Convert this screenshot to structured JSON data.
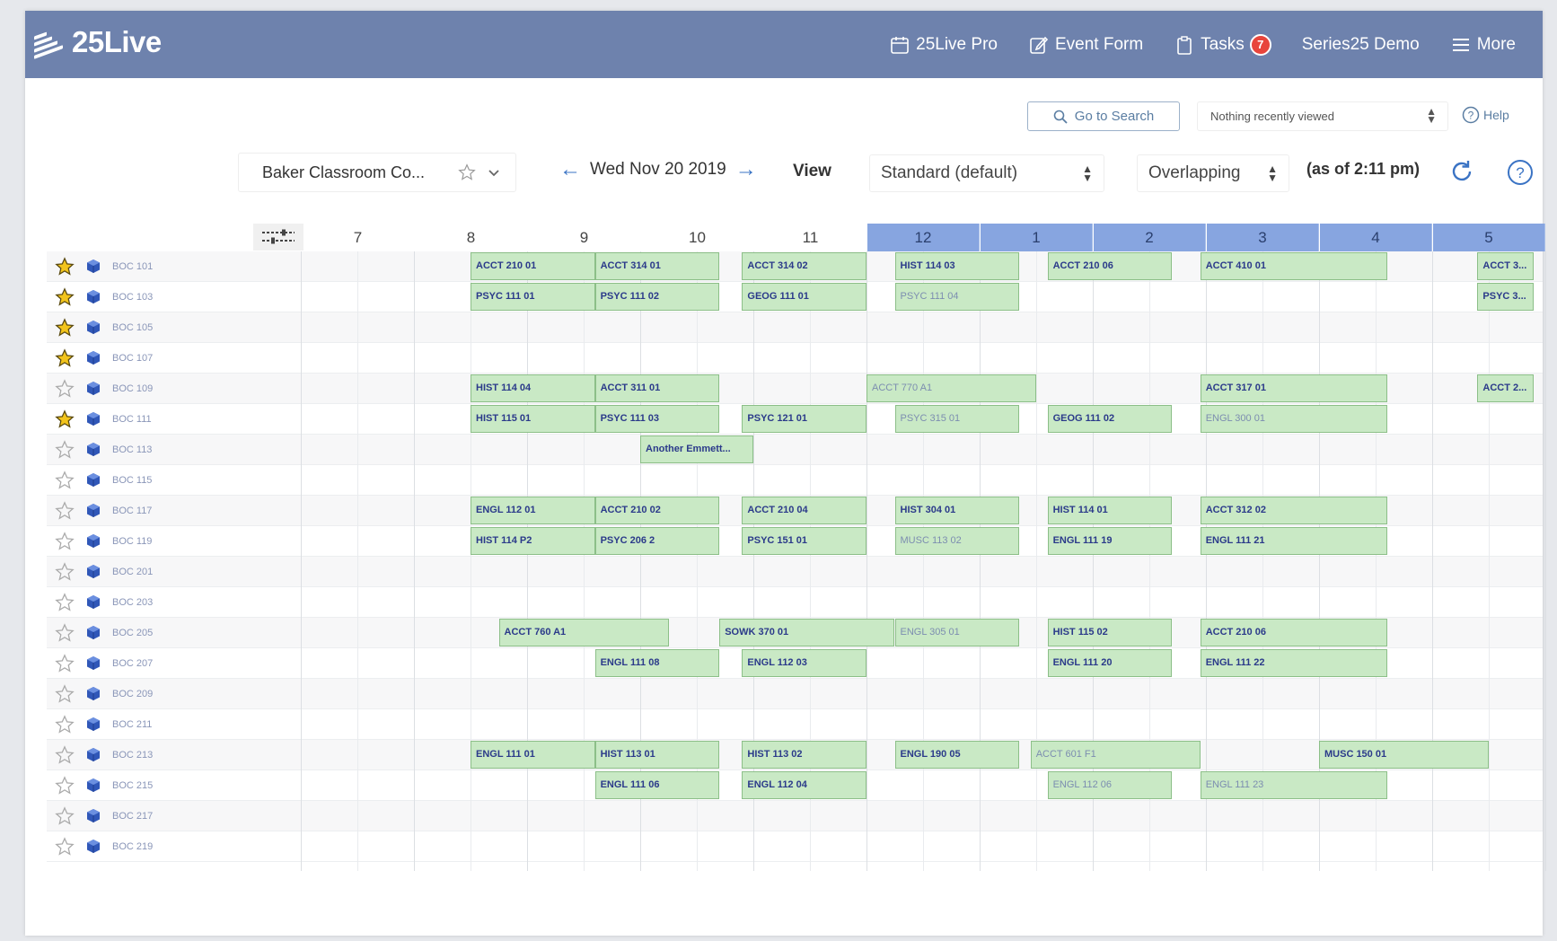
{
  "header": {
    "logo_text": "25Live",
    "nav": [
      {
        "label": "25Live Pro",
        "icon": "calendar-icon"
      },
      {
        "label": "Event Form",
        "icon": "edit-icon"
      },
      {
        "label": "Tasks",
        "icon": "clipboard-icon",
        "badge": "7"
      },
      {
        "label": "Series25 Demo",
        "icon": ""
      },
      {
        "label": "More",
        "icon": "menu-icon"
      }
    ]
  },
  "toolbar": {
    "go_to_search": "Go to Search",
    "recently_viewed": "Nothing recently viewed",
    "help": "Help"
  },
  "controls": {
    "selector": "Baker Classroom Co...",
    "date": "Wed Nov 20 2019",
    "view_label": "View",
    "view_value": "Standard (default)",
    "overlap_value": "Overlapping",
    "as_of": "(as of 2:11 pm)"
  },
  "hours": [
    "7",
    "8",
    "9",
    "10",
    "11",
    "12",
    "1",
    "2",
    "3",
    "4",
    "5"
  ],
  "highlight_start_hour": "12",
  "colors": {
    "topbar": "#6e82ad",
    "event_fill": "#c9e9c5",
    "event_text": "#2b3a8a",
    "pm_header": "#87a5e0",
    "badge": "#e8453c"
  },
  "rooms": [
    {
      "name": "BOC 101",
      "favorite": true
    },
    {
      "name": "BOC 103",
      "favorite": true
    },
    {
      "name": "BOC 105",
      "favorite": true
    },
    {
      "name": "BOC 107",
      "favorite": true
    },
    {
      "name": "BOC 109",
      "favorite": false
    },
    {
      "name": "BOC 111",
      "favorite": true
    },
    {
      "name": "BOC 113",
      "favorite": false
    },
    {
      "name": "BOC 115",
      "favorite": false
    },
    {
      "name": "BOC 117",
      "favorite": false
    },
    {
      "name": "BOC 119",
      "favorite": false
    },
    {
      "name": "BOC 201",
      "favorite": false
    },
    {
      "name": "BOC 203",
      "favorite": false
    },
    {
      "name": "BOC 205",
      "favorite": false
    },
    {
      "name": "BOC 207",
      "favorite": false
    },
    {
      "name": "BOC 209",
      "favorite": false
    },
    {
      "name": "BOC 211",
      "favorite": false
    },
    {
      "name": "BOC 213",
      "favorite": false
    },
    {
      "name": "BOC 215",
      "favorite": false
    },
    {
      "name": "BOC 217",
      "favorite": false
    },
    {
      "name": "BOC 219",
      "favorite": false
    }
  ],
  "events": [
    {
      "row": 0,
      "start": 8.0,
      "end": 9.1,
      "label": "ACCT 210 01"
    },
    {
      "row": 0,
      "start": 9.1,
      "end": 10.2,
      "label": "ACCT 314 01"
    },
    {
      "row": 0,
      "start": 10.4,
      "end": 11.5,
      "label": "ACCT 314 02"
    },
    {
      "row": 0,
      "start": 11.75,
      "end": 12.85,
      "label": "HIST 114 03"
    },
    {
      "row": 0,
      "start": 13.1,
      "end": 14.2,
      "label": "ACCT 210 06"
    },
    {
      "row": 0,
      "start": 14.45,
      "end": 16.1,
      "label": "ACCT 410 01"
    },
    {
      "row": 0,
      "start": 16.9,
      "end": 17.4,
      "label": "ACCT 3..."
    },
    {
      "row": 1,
      "start": 8.0,
      "end": 9.1,
      "label": "PSYC 111 01"
    },
    {
      "row": 1,
      "start": 9.1,
      "end": 10.2,
      "label": "PSYC 111 02"
    },
    {
      "row": 1,
      "start": 10.4,
      "end": 11.5,
      "label": "GEOG 111 01"
    },
    {
      "row": 1,
      "start": 11.75,
      "end": 12.85,
      "label": "PSYC 111 04",
      "faint": true
    },
    {
      "row": 1,
      "start": 16.9,
      "end": 17.4,
      "label": "PSYC 3..."
    },
    {
      "row": 4,
      "start": 8.0,
      "end": 9.1,
      "label": "HIST 114 04"
    },
    {
      "row": 4,
      "start": 9.1,
      "end": 10.2,
      "label": "ACCT 311 01"
    },
    {
      "row": 4,
      "start": 11.5,
      "end": 13.0,
      "label": "ACCT 770 A1",
      "faint": true
    },
    {
      "row": 4,
      "start": 14.45,
      "end": 16.1,
      "label": "ACCT 317 01"
    },
    {
      "row": 4,
      "start": 16.9,
      "end": 17.4,
      "label": "ACCT 2..."
    },
    {
      "row": 5,
      "start": 8.0,
      "end": 9.1,
      "label": "HIST 115 01"
    },
    {
      "row": 5,
      "start": 9.1,
      "end": 10.2,
      "label": "PSYC 111 03"
    },
    {
      "row": 5,
      "start": 10.4,
      "end": 11.5,
      "label": "PSYC 121 01"
    },
    {
      "row": 5,
      "start": 11.75,
      "end": 12.85,
      "label": "PSYC 315 01",
      "faint": true
    },
    {
      "row": 5,
      "start": 13.1,
      "end": 14.2,
      "label": "GEOG 111 02"
    },
    {
      "row": 5,
      "start": 14.45,
      "end": 16.1,
      "label": "ENGL 300 01",
      "faint": true
    },
    {
      "row": 6,
      "start": 9.5,
      "end": 10.5,
      "label": "Another Emmett..."
    },
    {
      "row": 8,
      "start": 8.0,
      "end": 9.1,
      "label": "ENGL 112 01"
    },
    {
      "row": 8,
      "start": 9.1,
      "end": 10.2,
      "label": "ACCT 210 02"
    },
    {
      "row": 8,
      "start": 10.4,
      "end": 11.5,
      "label": "ACCT 210 04"
    },
    {
      "row": 8,
      "start": 11.75,
      "end": 12.85,
      "label": "HIST 304 01"
    },
    {
      "row": 8,
      "start": 13.1,
      "end": 14.2,
      "label": "HIST 114 01"
    },
    {
      "row": 8,
      "start": 14.45,
      "end": 16.1,
      "label": "ACCT 312 02"
    },
    {
      "row": 9,
      "start": 8.0,
      "end": 9.1,
      "label": "HIST 114 P2"
    },
    {
      "row": 9,
      "start": 9.1,
      "end": 10.2,
      "label": "PSYC 206 2"
    },
    {
      "row": 9,
      "start": 10.4,
      "end": 11.5,
      "label": "PSYC 151 01"
    },
    {
      "row": 9,
      "start": 11.75,
      "end": 12.85,
      "label": "MUSC 113 02",
      "faint": true
    },
    {
      "row": 9,
      "start": 13.1,
      "end": 14.2,
      "label": "ENGL 111 19"
    },
    {
      "row": 9,
      "start": 14.45,
      "end": 16.1,
      "label": "ENGL 111 21"
    },
    {
      "row": 12,
      "start": 8.25,
      "end": 9.75,
      "label": "ACCT 760 A1"
    },
    {
      "row": 12,
      "start": 10.2,
      "end": 11.75,
      "label": "SOWK 370 01"
    },
    {
      "row": 12,
      "start": 11.75,
      "end": 12.85,
      "label": "ENGL 305 01",
      "faint": true
    },
    {
      "row": 12,
      "start": 13.1,
      "end": 14.2,
      "label": "HIST 115 02"
    },
    {
      "row": 12,
      "start": 14.45,
      "end": 16.1,
      "label": "ACCT 210 06"
    },
    {
      "row": 13,
      "start": 9.1,
      "end": 10.2,
      "label": "ENGL 111 08"
    },
    {
      "row": 13,
      "start": 10.4,
      "end": 11.5,
      "label": "ENGL 112 03"
    },
    {
      "row": 13,
      "start": 13.1,
      "end": 14.2,
      "label": "ENGL 111 20"
    },
    {
      "row": 13,
      "start": 14.45,
      "end": 16.1,
      "label": "ENGL 111 22"
    },
    {
      "row": 16,
      "start": 8.0,
      "end": 9.1,
      "label": "ENGL 111 01"
    },
    {
      "row": 16,
      "start": 9.1,
      "end": 10.2,
      "label": "HIST 113 01"
    },
    {
      "row": 16,
      "start": 10.4,
      "end": 11.5,
      "label": "HIST 113 02"
    },
    {
      "row": 16,
      "start": 11.75,
      "end": 12.85,
      "label": "ENGL 190 05"
    },
    {
      "row": 16,
      "start": 12.95,
      "end": 14.45,
      "label": "ACCT 601 F1",
      "faint": true
    },
    {
      "row": 16,
      "start": 15.5,
      "end": 17.0,
      "label": "MUSC 150 01"
    },
    {
      "row": 17,
      "start": 9.1,
      "end": 10.2,
      "label": "ENGL 111 06"
    },
    {
      "row": 17,
      "start": 10.4,
      "end": 11.5,
      "label": "ENGL 112 04"
    },
    {
      "row": 17,
      "start": 13.1,
      "end": 14.2,
      "label": "ENGL 112 06",
      "faint": true
    },
    {
      "row": 17,
      "start": 14.45,
      "end": 16.1,
      "label": "ENGL 111 23",
      "faint": true
    }
  ]
}
